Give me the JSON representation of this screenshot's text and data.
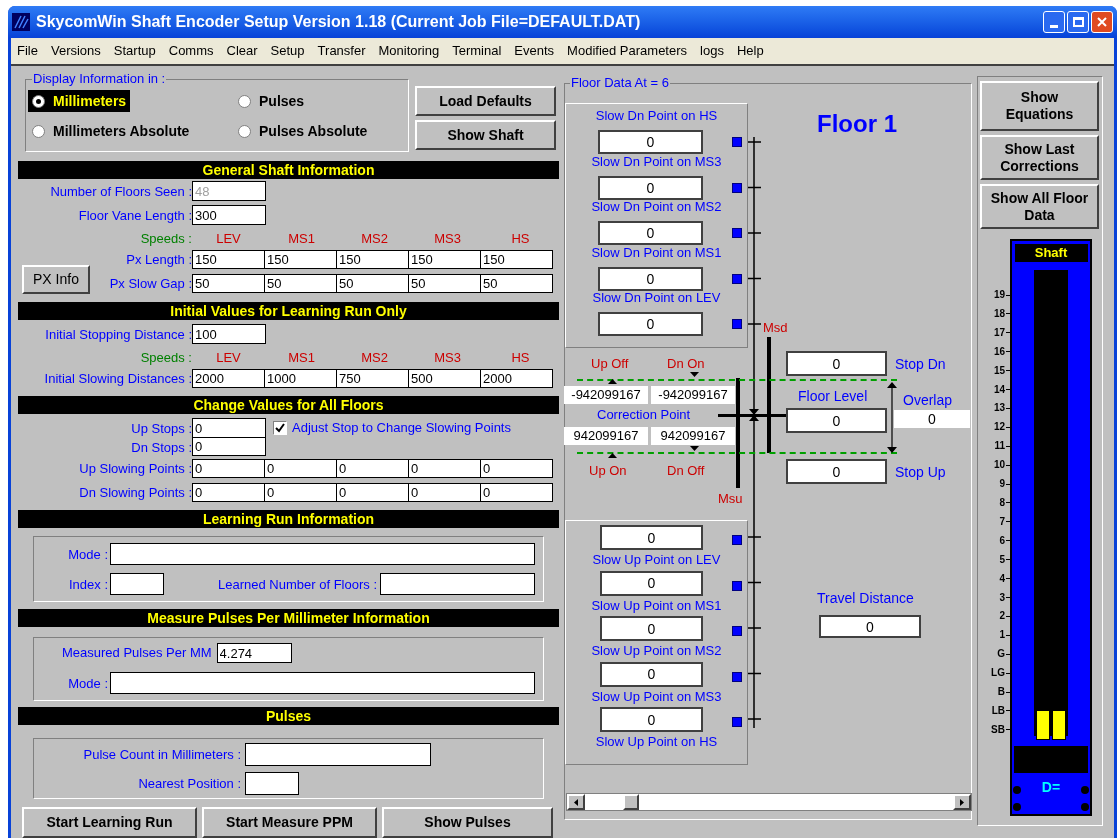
{
  "window": {
    "title": "SkycomWin Shaft Encoder Setup Version 1.18 (Current Job File=DEFAULT.DAT)"
  },
  "menu": [
    "File",
    "Versions",
    "Startup",
    "Comms",
    "Clear",
    "Setup",
    "Transfer",
    "Monitoring",
    "Terminal",
    "Events",
    "Modified Parameters",
    "logs",
    "Help"
  ],
  "display": {
    "legend": "Display Information in :",
    "options": [
      {
        "label": "Millimeters",
        "selected": true
      },
      {
        "label": "Pulses",
        "selected": false
      },
      {
        "label": "Millimeters Absolute",
        "selected": false
      },
      {
        "label": "Pulses Absolute",
        "selected": false
      }
    ],
    "buttons": [
      "Load Defaults",
      "Show Shaft"
    ]
  },
  "general": {
    "heading": "General Shaft Information",
    "fields": [
      {
        "label": "Number of Floors Seen :",
        "value": "48",
        "disabled": true
      },
      {
        "label": "Floor Vane Length :",
        "value": "300",
        "disabled": false
      }
    ],
    "speeds_label": "Speeds :",
    "speeds": [
      "LEV",
      "MS1",
      "MS2",
      "MS3",
      "HS"
    ],
    "button": "PX Info",
    "rows": [
      {
        "label": "Px Length :",
        "values": [
          "150",
          "150",
          "150",
          "150",
          "150"
        ]
      },
      {
        "label": "Px Slow Gap :",
        "values": [
          "50",
          "50",
          "50",
          "50",
          "50"
        ]
      }
    ]
  },
  "initial": {
    "heading": "Initial Values for Learning Run Only",
    "field": {
      "label": "Initial Stopping Distance :",
      "value": "100"
    },
    "speeds_label": "Speeds :",
    "speeds": [
      "LEV",
      "MS1",
      "MS2",
      "MS3",
      "HS"
    ],
    "rows": [
      {
        "label": "Initial Slowing Distances :",
        "values": [
          "2000",
          "1000",
          "750",
          "500",
          "2000"
        ]
      }
    ]
  },
  "change": {
    "heading": "Change Values for All Floors",
    "up_stops": {
      "label": "Up Stops :",
      "value": "0"
    },
    "adjust": {
      "label": "Adjust Stop to Change Slowing Points",
      "checked": true
    },
    "dn_stops": {
      "label": "Dn Stops :",
      "value": "0"
    },
    "rows": [
      {
        "label": "Up Slowing Points :",
        "values": [
          "0",
          "0",
          "0",
          "0",
          "0"
        ]
      },
      {
        "label": "Dn Slowing Points :",
        "values": [
          "0",
          "0",
          "0",
          "0",
          "0"
        ]
      }
    ]
  },
  "learning": {
    "heading": "Learning Run Information",
    "mode_label": "Mode :",
    "index_label": "Index :",
    "learned_floors_label": "Learned Number of Floors :"
  },
  "measure": {
    "heading": "Measure Pulses Per Millimeter Information",
    "measured": {
      "label": "Measured Pulses Per MM",
      "value": "4.274"
    },
    "mode_label": "Mode :"
  },
  "pulses": {
    "heading": "Pulses",
    "count_label": "Pulse Count in Millimeters :",
    "nearest_label": "Nearest Position :"
  },
  "actions": [
    "Start Learning Run",
    "Start Measure PPM",
    "Show Pulses"
  ],
  "floor_data": {
    "legend": "Floor Data At = 6",
    "floor_title": "Floor 1",
    "slow_dn_points": [
      {
        "label": "Slow Dn Point on HS",
        "value": "0"
      },
      {
        "label": "Slow Dn Point on MS3",
        "value": "0"
      },
      {
        "label": "Slow Dn Point on MS2",
        "value": "0"
      },
      {
        "label": "Slow Dn Point on MS1",
        "value": "0"
      },
      {
        "label": "Slow Dn Point on LEV",
        "value": "0"
      }
    ],
    "msd": "Msd",
    "msu": "Msu",
    "up_off": "Up Off",
    "dn_on": "Dn On",
    "up_on": "Up On",
    "dn_off": "Dn Off",
    "correction_label": "Correction Point",
    "correction_values": [
      "-942099167",
      "-942099167",
      "942099167",
      "942099167"
    ],
    "stop_dn": {
      "label": "Stop Dn",
      "value": "0"
    },
    "floor_level": {
      "label": "Floor Level",
      "value": "0"
    },
    "overlap": {
      "label": "Overlap",
      "value": "0"
    },
    "stop_up": {
      "label": "Stop Up",
      "value": "0"
    },
    "slow_up_points": [
      {
        "label": "Slow Up Point on LEV",
        "value": "0"
      },
      {
        "label": "Slow Up Point on MS1",
        "value": "0"
      },
      {
        "label": "Slow Up Point on MS2",
        "value": "0"
      },
      {
        "label": "Slow Up Point on MS3",
        "value": "0"
      },
      {
        "label": "Slow Up Point on HS",
        "value": "0"
      }
    ],
    "travel_distance": {
      "label": "Travel Distance",
      "value": "0"
    }
  },
  "side_buttons": [
    "Show Equations",
    "Show Last Corrections",
    "Show All Floor Data"
  ],
  "shaft": {
    "title": "Shaft",
    "floors": [
      "19",
      "18",
      "17",
      "16",
      "15",
      "14",
      "13",
      "12",
      "11",
      "10",
      "9",
      "8",
      "7",
      "6",
      "5",
      "4",
      "3",
      "2",
      "1",
      "G",
      "LG",
      "B",
      "LB",
      "SB"
    ],
    "readout": "D="
  }
}
